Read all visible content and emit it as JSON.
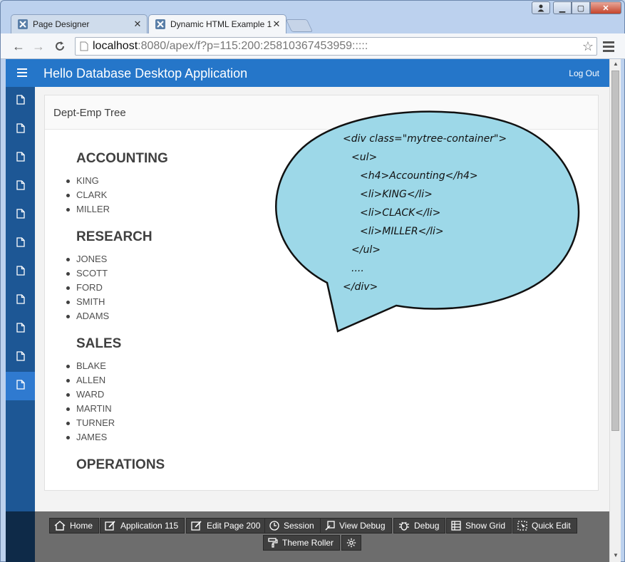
{
  "browser": {
    "tabs": [
      {
        "label": "Page Designer",
        "active": false
      },
      {
        "label": "Dynamic HTML Example 1",
        "active": true
      }
    ],
    "url_host": "localhost",
    "url_path": ":8080/apex/f?p=115:200:25810367453959:::::"
  },
  "app": {
    "title": "Hello Database Desktop Application",
    "logout_label": "Log Out",
    "accent_color": "#2576c9",
    "sidebar_color": "#1d5795"
  },
  "region": {
    "title": "Dept-Emp Tree"
  },
  "tree": [
    {
      "dept": "ACCOUNTING",
      "emps": [
        "KING",
        "CLARK",
        "MILLER"
      ]
    },
    {
      "dept": "RESEARCH",
      "emps": [
        "JONES",
        "SCOTT",
        "FORD",
        "SMITH",
        "ADAMS"
      ]
    },
    {
      "dept": "SALES",
      "emps": [
        "BLAKE",
        "ALLEN",
        "WARD",
        "MARTIN",
        "TURNER",
        "JAMES"
      ]
    },
    {
      "dept": "OPERATIONS",
      "emps": []
    }
  ],
  "bubble": {
    "fill": "#9dd8e8",
    "lines": [
      "<div class=\"mytree-container\">",
      "<ul>",
      "<h4>Accounting</h4>",
      "<li>KING</li>",
      "<li>CLACK</li>",
      "<li>MILLER</li>",
      "</ul>",
      "....",
      "</div>"
    ]
  },
  "devbar": {
    "home": "Home",
    "application": "Application 115",
    "edit_page": "Edit Page 200",
    "session": "Session",
    "view_debug": "View Debug",
    "debug": "Debug",
    "show_grid": "Show Grid",
    "quick_edit": "Quick Edit",
    "theme_roller": "Theme Roller"
  }
}
